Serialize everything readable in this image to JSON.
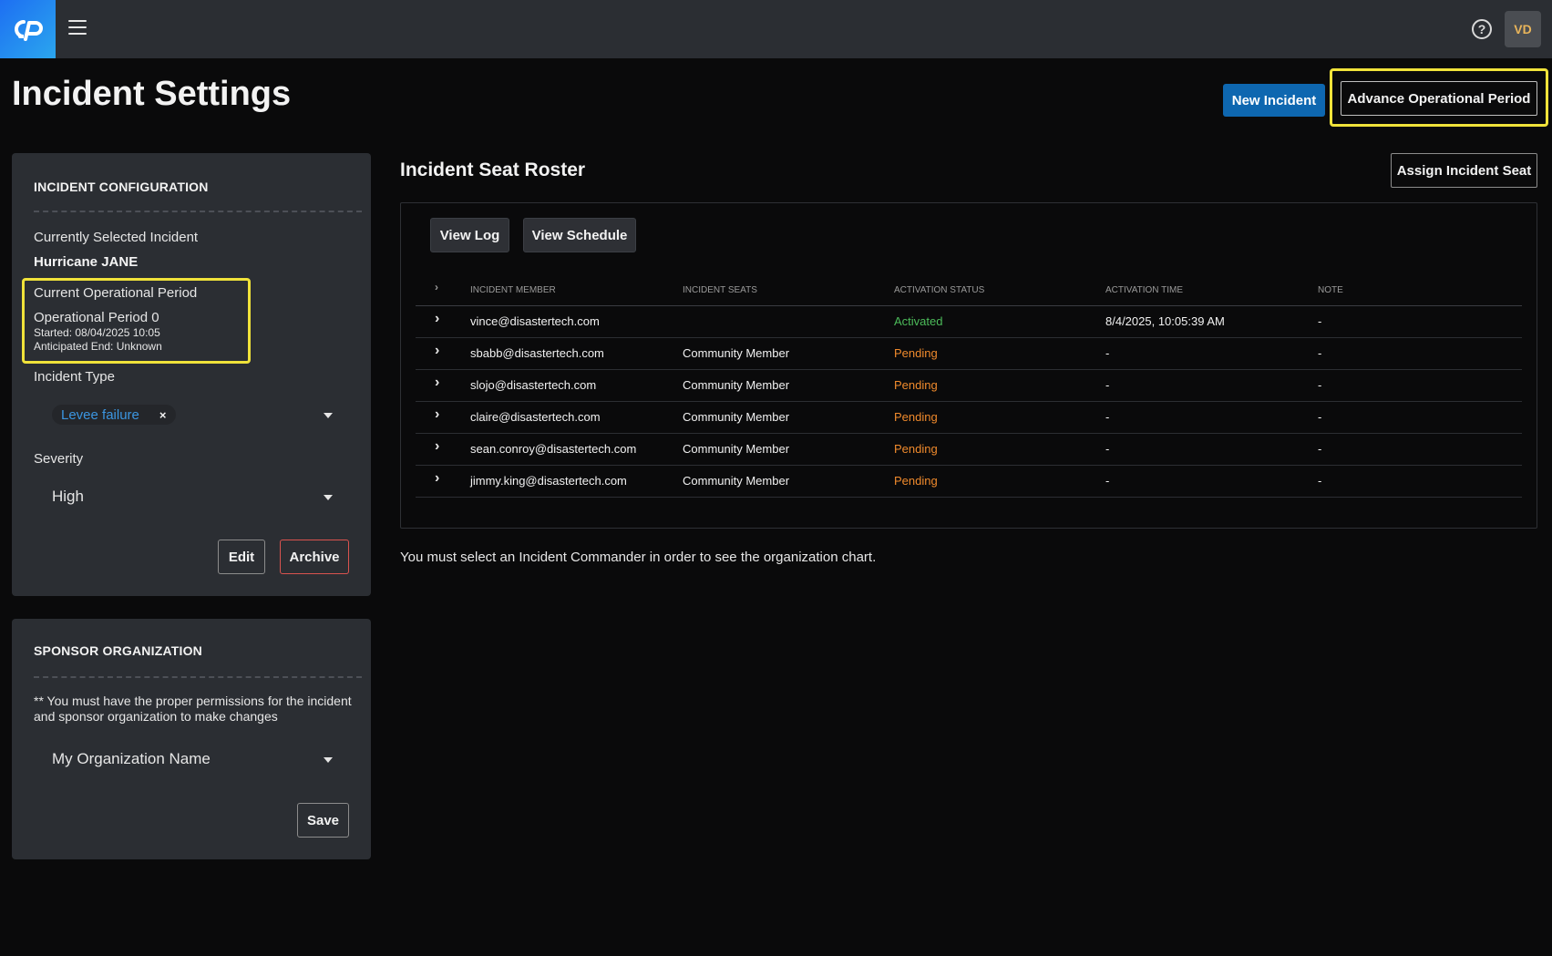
{
  "topbar": {
    "logo_icon": "app-logo",
    "menu_icon": "hamburger-menu-icon",
    "help_icon": "?",
    "avatar_initials": "VD"
  },
  "page": {
    "title": "Incident Settings",
    "new_incident_label": "New Incident",
    "advance_period_label": "Advance Operational Period"
  },
  "config_panel": {
    "heading": "INCIDENT CONFIGURATION",
    "selected_incident_label": "Currently Selected Incident",
    "selected_incident_value": "Hurricane JANE",
    "op_period_label": "Current Operational Period",
    "op_period_name": "Operational Period 0",
    "op_period_started": "Started: 08/04/2025 10:05",
    "op_period_end": "Anticipated End: Unknown",
    "incident_type_label": "Incident Type",
    "incident_type_chip": "Levee failure",
    "chip_remove": "×",
    "severity_label": "Severity",
    "severity_value": "High",
    "edit_label": "Edit",
    "archive_label": "Archive"
  },
  "sponsor_panel": {
    "heading": "SPONSOR ORGANIZATION",
    "note": "** You must have the proper permissions for the incident and sponsor organization to make changes",
    "org_value": "My Organization Name",
    "save_label": "Save"
  },
  "roster": {
    "title": "Incident Seat Roster",
    "assign_label": "Assign Incident Seat",
    "view_log_label": "View Log",
    "view_schedule_label": "View Schedule",
    "columns": [
      "INCIDENT MEMBER",
      "INCIDENT SEATS",
      "ACTIVATION STATUS",
      "ACTIVATION TIME",
      "NOTE"
    ],
    "rows": [
      {
        "member": "vince@disastertech.com",
        "seat": "",
        "status": "Activated",
        "time": "8/4/2025, 10:05:39 AM",
        "note": "-"
      },
      {
        "member": "sbabb@disastertech.com",
        "seat": "Community Member",
        "status": "Pending",
        "time": "-",
        "note": "-"
      },
      {
        "member": "slojo@disastertech.com",
        "seat": "Community Member",
        "status": "Pending",
        "time": "-",
        "note": "-"
      },
      {
        "member": "claire@disastertech.com",
        "seat": "Community Member",
        "status": "Pending",
        "time": "-",
        "note": "-"
      },
      {
        "member": "sean.conroy@disastertech.com",
        "seat": "Community Member",
        "status": "Pending",
        "time": "-",
        "note": "-"
      },
      {
        "member": "jimmy.king@disastertech.com",
        "seat": "Community Member",
        "status": "Pending",
        "time": "-",
        "note": "-"
      }
    ],
    "org_chart_message": "You must select an Incident Commander in order to see the organization chart."
  },
  "colors": {
    "activated": "#4cbb5a",
    "pending": "#f08a2c",
    "highlight": "#f0e23a",
    "primary": "#0e67b0"
  }
}
